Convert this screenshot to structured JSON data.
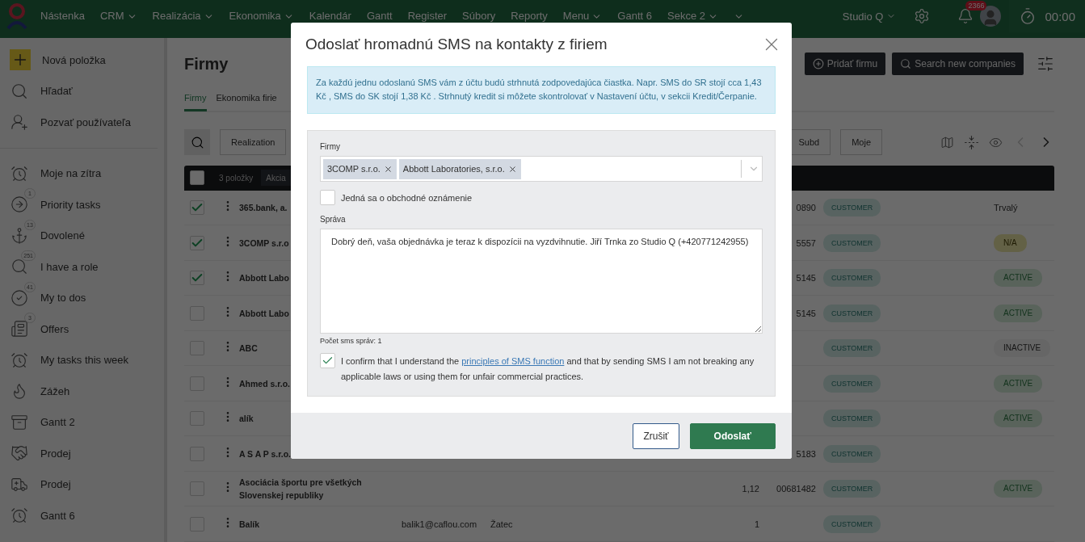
{
  "topbar": {
    "nav": [
      {
        "label": "Nástenka",
        "dropdown": false
      },
      {
        "label": "CRM",
        "dropdown": true
      },
      {
        "label": "Realizácia",
        "dropdown": true
      },
      {
        "label": "Ekonomika",
        "dropdown": true
      },
      {
        "label": "Kalendár",
        "dropdown": false
      },
      {
        "label": "Gantt",
        "dropdown": false
      },
      {
        "label": "Register",
        "dropdown": false
      },
      {
        "label": "Súbory",
        "dropdown": false
      },
      {
        "label": "Reporty",
        "dropdown": false
      },
      {
        "label": "Menu",
        "dropdown": true
      },
      {
        "label": "Gantt 6",
        "dropdown": false
      },
      {
        "label": "Sekce 2",
        "dropdown": true
      },
      {
        "dropdown": true
      }
    ],
    "account": "Studio Q",
    "notifications": "2366",
    "timer": "00:00"
  },
  "sidebar": {
    "actions": [
      {
        "label": "Nová položka",
        "kind": "new"
      },
      {
        "label": "Hľadať",
        "kind": "search"
      },
      {
        "label": "Pozvať používateľa",
        "kind": "invite"
      }
    ],
    "items": [
      {
        "label": "Moje na zítra"
      },
      {
        "label": "Priority tasks",
        "badge": "1"
      },
      {
        "label": "Dovolené",
        "badge": "13"
      },
      {
        "label": "I have a role",
        "badge": "251"
      },
      {
        "label": "My to dos",
        "badge": "41"
      },
      {
        "label": "Offers",
        "badge": "3"
      },
      {
        "label": "My tasks this week"
      },
      {
        "label": "Zážeh"
      },
      {
        "label": "Gantt 2"
      },
      {
        "label": "Prodej"
      },
      {
        "label": "Prodej"
      },
      {
        "label": "Gantt 6"
      }
    ]
  },
  "page": {
    "title": "Firmy",
    "buttons": [
      {
        "label": "Pridať firmu",
        "kind": "add"
      },
      {
        "label": "Search new companies",
        "kind": "search"
      }
    ],
    "tabs": [
      {
        "label": "Firmy",
        "selected": true
      },
      {
        "label": "Ekonomika firie",
        "selected": false
      }
    ],
    "filters": [
      "Realization"
    ],
    "right_filters": [
      "Subd",
      "Moje"
    ]
  },
  "table": {
    "select_all": false,
    "count": "3 položky",
    "action": "Akcia",
    "rows": [
      {
        "checked": true,
        "name": "365.bank, a.",
        "id": "0890",
        "type": "CUSTOMER",
        "status": {
          "kind": "text",
          "label": "Trvalý"
        }
      },
      {
        "checked": true,
        "name": "3COMP s.r.o",
        "id": "5557",
        "type": "CUSTOMER",
        "status": {
          "kind": "na",
          "label": "N/A"
        }
      },
      {
        "checked": true,
        "name": "Abbott Labo",
        "id": "5145",
        "type": "CUSTOMER",
        "status": {
          "kind": "active",
          "label": "ACTIVE"
        }
      },
      {
        "checked": false,
        "name": "Abbott Labo",
        "id": "5145",
        "type": "CUSTOMER",
        "status": {
          "kind": "active",
          "label": "ACTIVE"
        }
      },
      {
        "checked": false,
        "name": "ABC",
        "type": "CUSTOMER",
        "status": {
          "kind": "inactive",
          "label": "INACTIVE"
        }
      },
      {
        "checked": false,
        "name": "Ahmed s.r.o.",
        "type": "CUSTOMER",
        "status": {
          "kind": "active",
          "label": "ACTIVE"
        }
      },
      {
        "checked": false,
        "name": "alík",
        "type": "CUSTOMER",
        "status": {
          "kind": "active",
          "label": "ACTIVE"
        }
      },
      {
        "checked": false,
        "name": "A S A P s.r.o.",
        "id": "5183",
        "type": "CUSTOMER"
      },
      {
        "checked": false,
        "name": "Asociácia športu pre všetkých Slovenskej republiky",
        "number": "1,12",
        "id": "00681482",
        "type": "CUSTOMER",
        "status": {
          "kind": "active",
          "label": "ACTIVE"
        }
      },
      {
        "checked": false,
        "name": "Balík",
        "email": "balik1@caflou.com",
        "city": "Žatec",
        "number": "1",
        "type": "CUSTOMER"
      }
    ]
  },
  "modal": {
    "title": "Odoslať hromadnú SMS na kontakty z firiem",
    "notice": "Za každú jednu odoslanú SMS vám z účtu budú strhnutá zodpovedajúca čiastka. Napr. SMS do SR stojí cca 1,43 Kč , SMS do SK stojí 1,38 Kč . Strhnutý kredit si môžete skontrolovať v Nastavení účtu, v sekcii Kredit/Čerpanie.",
    "companies": {
      "label": "Firmy",
      "chips": [
        "3COMP s.r.o.",
        "Abbott Laboratories, s.r.o."
      ]
    },
    "commercial": {
      "label": "Jedná sa o obchodné oznámenie",
      "checked": false
    },
    "message": {
      "label": "Správa",
      "value": "Dobrý deň, vaša objednávka je teraz k dispozícii na vyzdvihnutie. Jiří Trnka zo Studio Q (+420771242955)"
    },
    "sms_count": "Počet sms správ: 1",
    "confirm": {
      "checked": true,
      "before": "I confirm that I understand the",
      "link": "principles of SMS function",
      "after": "and that by sending SMS I am not breaking any applicable laws or using them for unfair commercial practices."
    },
    "buttons": [
      {
        "label": "Zrušiť",
        "kind": "secondary"
      },
      {
        "label": "Odoslať",
        "kind": "primary"
      }
    ]
  }
}
